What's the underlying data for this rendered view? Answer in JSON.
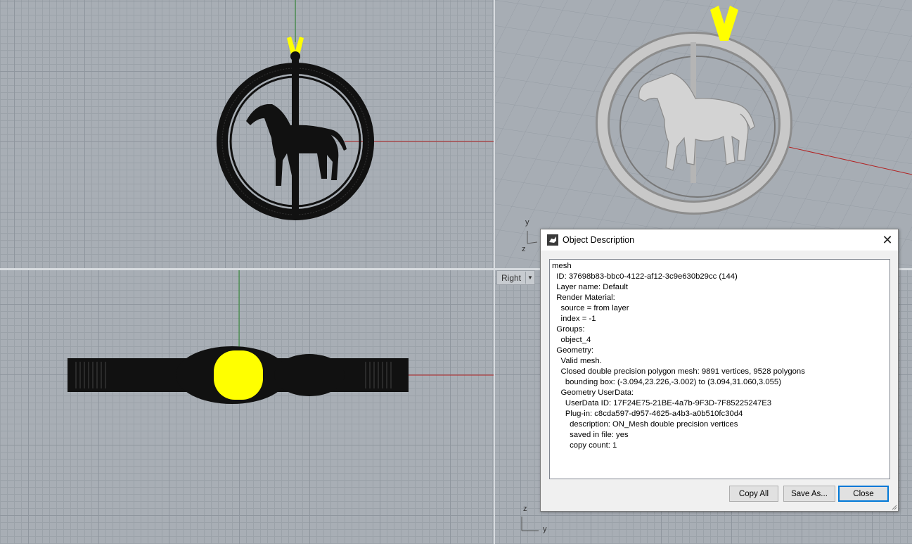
{
  "viewports": {
    "right_label": "Right",
    "right_menu_icon": "chevron-down-icon"
  },
  "axis_labels": {
    "persp_y": "y",
    "persp_z": "z",
    "right_z": "z",
    "right_y": "y"
  },
  "dialog": {
    "title": "Object Description",
    "icon": "rhino-icon",
    "lines": [
      "mesh",
      "  ID: 37698b83-bbc0-4122-af12-3c9e630b29cc (144)",
      "  Layer name: Default",
      "  Render Material:",
      "    source = from layer",
      "    index = -1",
      "  Groups:",
      "    object_4",
      "  Geometry:",
      "    Valid mesh.",
      "    Closed double precision polygon mesh: 9891 vertices, 9528 polygons",
      "      bounding box: (-3.094,23.226,-3.002) to (3.094,31.060,3.055)",
      "    Geometry UserData:",
      "      UserData ID: 17F24E75-21BE-4a7b-9F3D-7F85225247E3",
      "      Plug-in: c8cda597-d957-4625-a4b3-a0b510fc30d4",
      "        description: ON_Mesh double precision vertices",
      "        saved in file: yes",
      "        copy count: 1"
    ],
    "buttons": {
      "copy_all": "Copy All",
      "save_as": "Save As...",
      "close": "Close"
    }
  },
  "colors": {
    "viewport_bg": "#a8aeb5",
    "x_axis": "#b22222",
    "y_axis": "#2e8b2e",
    "selection": "#ffff00",
    "mesh_black": "#111111"
  }
}
